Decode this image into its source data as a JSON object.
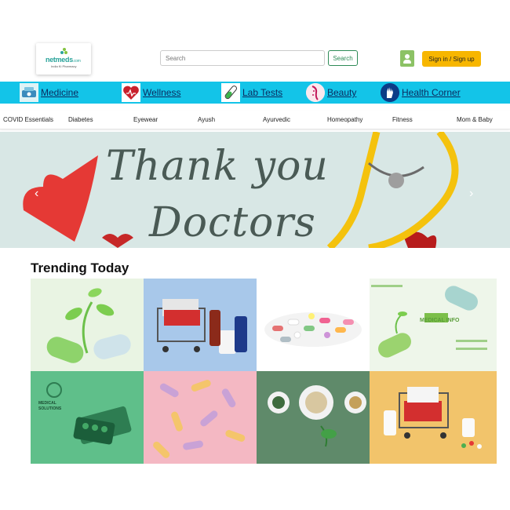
{
  "logo": {
    "name": "netmeds",
    "suffix": ".com",
    "tagline": "India Ki Pharmacy"
  },
  "search": {
    "placeholder": "Search",
    "button_label": "Search"
  },
  "account": {
    "signin_label": "Sign in / Sign up"
  },
  "main_nav": [
    {
      "label": "Medicine",
      "icon": "medicine-icon"
    },
    {
      "label": "Wellness",
      "icon": "wellness-heart-icon"
    },
    {
      "label": "Lab Tests",
      "icon": "test-tube-icon"
    },
    {
      "label": "Beauty",
      "icon": "beauty-icon"
    },
    {
      "label": "Health Corner",
      "icon": "health-hand-icon"
    }
  ],
  "sub_nav": [
    "COVID Essentials",
    "Diabetes",
    "Eyewear",
    "Ayush",
    "Ayurvedic",
    "Homeopathy",
    "Fitness",
    "Mom & Baby"
  ],
  "banner": {
    "line1": "Thank you",
    "line2": "Doctors",
    "prev_arrow": "‹",
    "next_arrow": "›"
  },
  "trending": {
    "title": "Trending Today",
    "tiles": [
      {
        "name": "capsule-plant"
      },
      {
        "name": "shopping-cart-pills"
      },
      {
        "name": "assorted-pills"
      },
      {
        "name": "medical-info",
        "caption": "MEDICAL INFO"
      },
      {
        "name": "medical-solutions",
        "caption": "MEDICAL SOLUTIONS"
      },
      {
        "name": "softgel-capsules"
      },
      {
        "name": "herbal-bowls"
      },
      {
        "name": "cart-with-bottles"
      }
    ]
  },
  "colors": {
    "nav_bar": "#13c4e8",
    "brand": "#2aa39a",
    "signin": "#f7b600",
    "search_border": "#2e8b57"
  }
}
